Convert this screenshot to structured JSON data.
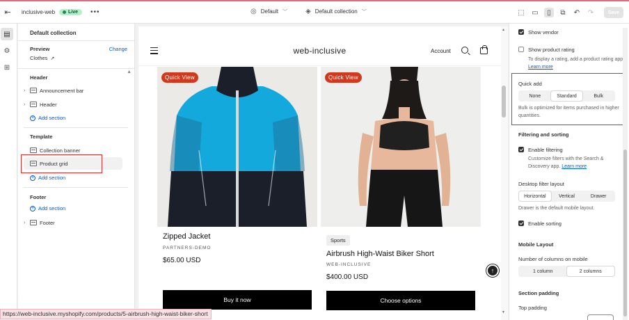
{
  "topbar": {
    "store_name": "inclusive-web",
    "live_label": "Live",
    "theme_select": "Default",
    "template_select": "Default collection",
    "save_label": "Save"
  },
  "sidebar": {
    "title": "Default collection",
    "preview_label": "Preview",
    "preview_value": "Clothes",
    "change_label": "Change",
    "header_group": "Header",
    "announcement_bar": "Announcement bar",
    "header_item": "Header",
    "add_section": "Add section",
    "template_group": "Template",
    "collection_banner": "Collection banner",
    "product_grid": "Product grid",
    "footer_group": "Footer",
    "footer_item": "Footer"
  },
  "store": {
    "logo": "web-inclusive",
    "account": "Account",
    "products": [
      {
        "badge": "Quick View",
        "title": "Zipped Jacket",
        "vendor": "PARTNERS-DEMO",
        "price": "$65.00 USD",
        "button": "Buy it now"
      },
      {
        "badge": "Quick View",
        "tag": "Sports",
        "title": "Airbrush High-Waist Biker Short",
        "vendor": "WEB-INCLUSIVE",
        "price": "$400.00 USD",
        "button": "Choose options"
      }
    ]
  },
  "settings": {
    "show_vendor": "Show vendor",
    "show_rating": "Show product rating",
    "rating_help": "To display a rating, add a product rating app.",
    "learn_more": "Learn more",
    "quick_add_label": "Quick add",
    "quick_add_options": [
      "None",
      "Standard",
      "Bulk"
    ],
    "quick_add_selected": "Standard",
    "quick_add_desc": "Bulk is optimized for items purchased in higher quantities.",
    "filtering_head": "Filtering and sorting",
    "enable_filtering": "Enable filtering",
    "filtering_help": "Customize filters with the Search & Discovery app.",
    "desktop_filter_label": "Desktop filter layout",
    "filter_options": [
      "Horizontal",
      "Vertical",
      "Drawer"
    ],
    "filter_selected": "Horizontal",
    "drawer_desc": "Drawer is the default mobile layout.",
    "enable_sorting": "Enable sorting",
    "mobile_head": "Mobile Layout",
    "mobile_cols_label": "Number of columns on mobile",
    "mobile_options": [
      "1 column",
      "2 columns"
    ],
    "mobile_selected": "2 columns",
    "padding_head": "Section padding",
    "top_padding": "Top padding"
  },
  "statusbar": {
    "url": "https://web-inclusive.myshopify.com/products/5-airbrush-high-waist-biker-short"
  },
  "colors": {
    "accent_link": "#005bd3",
    "live_badge": "#b3f1c7",
    "quick_view_badge": "#d0391e",
    "jacket_blue": "#14a9dd",
    "annotation_red": "#e02b2b"
  }
}
